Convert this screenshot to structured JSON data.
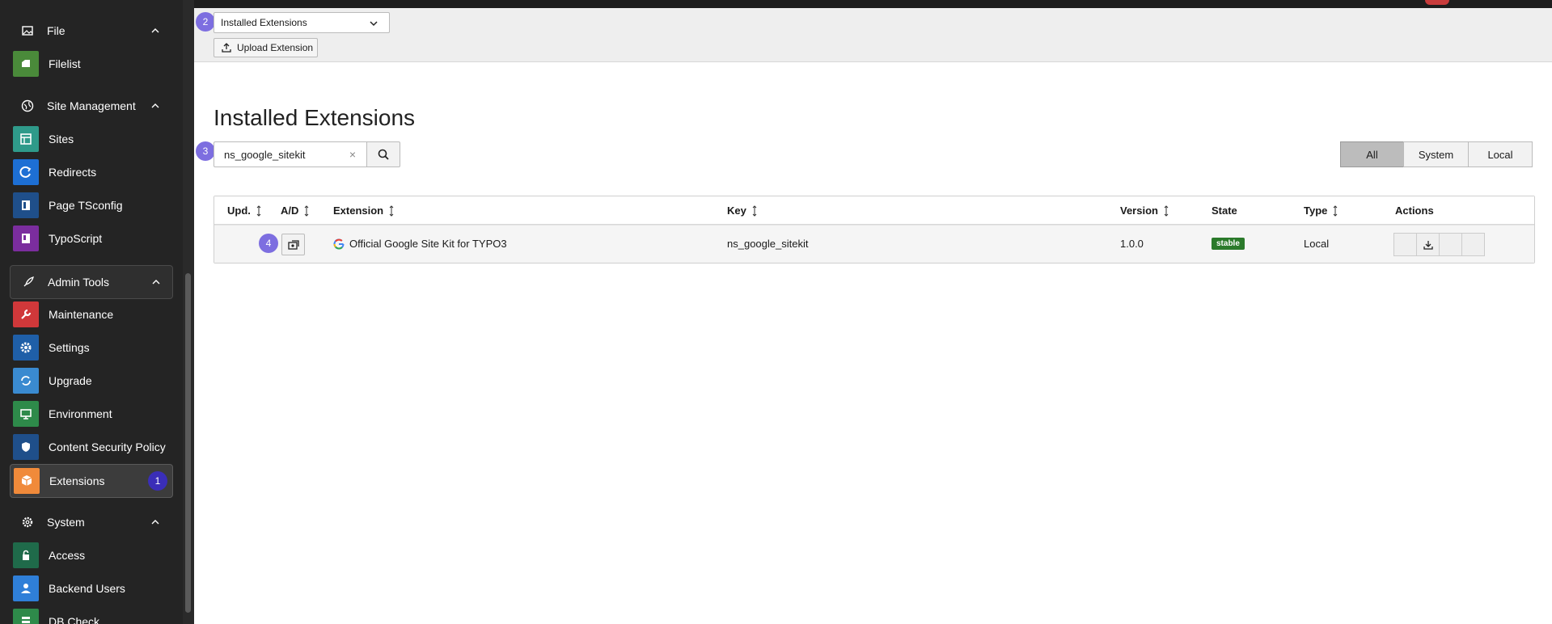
{
  "sidebar": {
    "groups": [
      {
        "id": "file",
        "label": "File",
        "items": [
          {
            "label": "Filelist",
            "color": "#4a8a3a"
          }
        ]
      },
      {
        "id": "site",
        "label": "Site Management",
        "items": [
          {
            "label": "Sites",
            "color": "#2f9a8a"
          },
          {
            "label": "Redirects",
            "color": "#1d6fd4"
          },
          {
            "label": "Page TSconfig",
            "color": "#1f4f8a"
          },
          {
            "label": "TypoScript",
            "color": "#7b2d9e"
          }
        ]
      },
      {
        "id": "admin",
        "label": "Admin Tools",
        "items": [
          {
            "label": "Maintenance",
            "color": "#d0383a"
          },
          {
            "label": "Settings",
            "color": "#1f5fa8"
          },
          {
            "label": "Upgrade",
            "color": "#3a8ad0"
          },
          {
            "label": "Environment",
            "color": "#2e8a4a"
          },
          {
            "label": "Content Security Policy",
            "color": "#1f4f8a"
          },
          {
            "label": "Extensions",
            "color": "#f08a3a",
            "badge": "1"
          }
        ]
      },
      {
        "id": "system",
        "label": "System",
        "items": [
          {
            "label": "Access",
            "color": "#1f6a4a"
          },
          {
            "label": "Backend Users",
            "color": "#2f7fd8"
          },
          {
            "label": "DB Check",
            "color": "#2e8a4a"
          }
        ]
      }
    ]
  },
  "header": {
    "select_value": "Installed Extensions",
    "select_badge": "2",
    "upload_label": "Upload Extension"
  },
  "main": {
    "title": "Installed Extensions",
    "search": {
      "value": "ns_google_sitekit",
      "badge": "3",
      "clear": "×"
    },
    "filters": [
      {
        "label": "All",
        "active": true
      },
      {
        "label": "System",
        "active": false
      },
      {
        "label": "Local",
        "active": false
      }
    ],
    "table": {
      "columns": [
        "Upd.",
        "A/D",
        "Extension",
        "Key",
        "Version",
        "State",
        "Type",
        "Actions"
      ],
      "rows": [
        {
          "badge": "4",
          "extension": "Official Google Site Kit for TYPO3",
          "key": "ns_google_sitekit",
          "version": "1.0.0",
          "state": "stable",
          "type": "Local"
        }
      ]
    }
  },
  "colors": {
    "annotation": "#7d6ee0",
    "annotation_dark": "#3a2eb8",
    "state_stable": "#2b7a2b"
  }
}
